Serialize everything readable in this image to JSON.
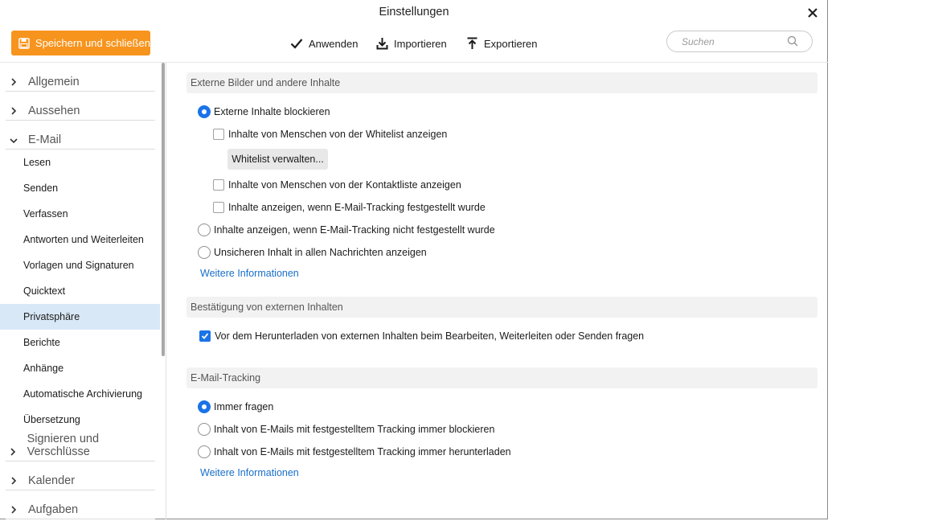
{
  "window": {
    "title": "Einstellungen"
  },
  "toolbar": {
    "save_close": "Speichern und schließen",
    "apply": "Anwenden",
    "import": "Importieren",
    "export": "Exportieren",
    "search_placeholder": "Suchen"
  },
  "sidebar": {
    "sections": {
      "allgemein": "Allgemein",
      "aussehen": "Aussehen",
      "email": "E-Mail",
      "signieren": "Signieren und Verschlüsse",
      "kalender": "Kalender",
      "aufgaben": "Aufgaben"
    },
    "email_items": [
      "Lesen",
      "Senden",
      "Verfassen",
      "Antworten und Weiterleiten",
      "Vorlagen und Signaturen",
      "Quicktext",
      "Privatsphäre",
      "Berichte",
      "Anhänge",
      "Automatische Archivierung",
      "Übersetzung"
    ],
    "active_item": "Privatsphäre"
  },
  "content": {
    "external": {
      "header": "Externe Bilder und andere Inhalte",
      "block_external": "Externe Inhalte blockieren",
      "show_whitelist": "Inhalte von Menschen von der Whitelist anzeigen",
      "manage_whitelist": "Whitelist verwalten...",
      "show_contacts": "Inhalte von Menschen von der Kontaktliste anzeigen",
      "show_if_tracking": "Inhalte anzeigen, wenn E-Mail-Tracking festgestellt wurde",
      "show_if_no_tracking": "Inhalte anzeigen, wenn E-Mail-Tracking nicht festgestellt wurde",
      "show_unsafe": "Unsicheren Inhalt in allen Nachrichten anzeigen",
      "more_info": "Weitere Informationen"
    },
    "confirm": {
      "header": "Bestätigung von externen Inhalten",
      "ask_before_download": "Vor dem Herunterladen von externen Inhalten beim Bearbeiten, Weiterleiten oder Senden fragen"
    },
    "tracking": {
      "header": "E-Mail-Tracking",
      "always_ask": "Immer fragen",
      "always_block": "Inhalt von E-Mails mit festgestelltem Tracking immer blockieren",
      "always_download": "Inhalt von E-Mails mit festgestelltem Tracking immer herunterladen",
      "more_info": "Weitere Informationen"
    }
  },
  "colors": {
    "accent": "#1a73e8",
    "save_button": "#f7941d",
    "active_item_bg": "#d9e8f7",
    "link": "#1a6fc9"
  }
}
